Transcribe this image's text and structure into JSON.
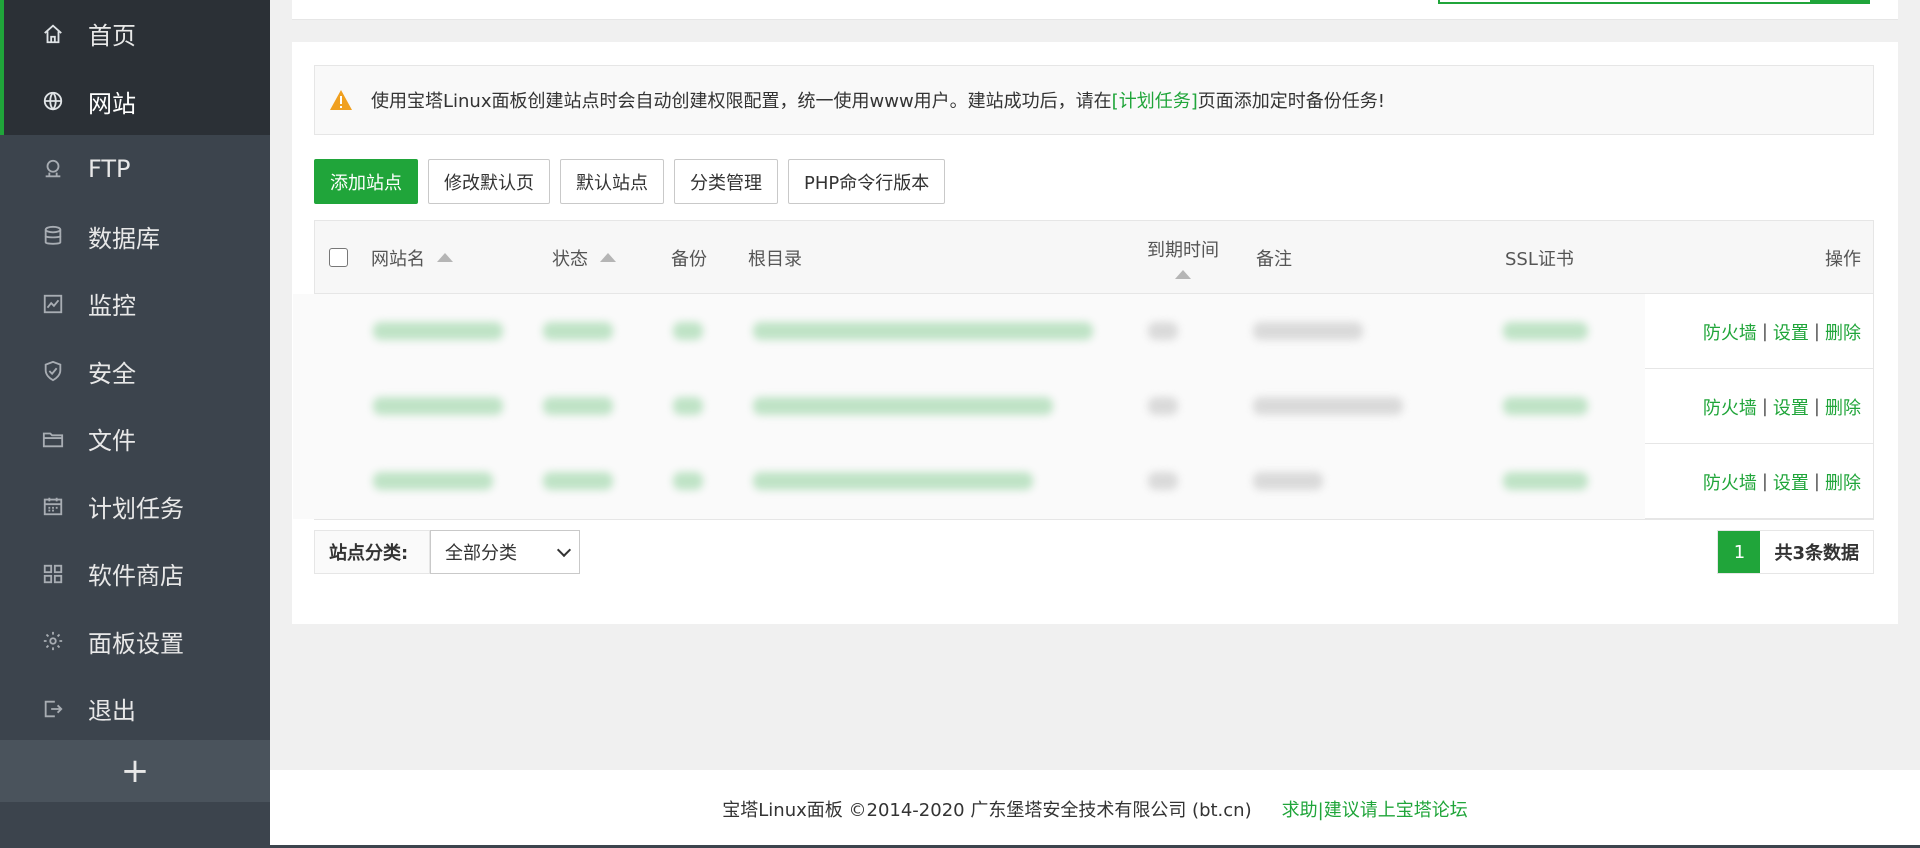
{
  "colors": {
    "accent": "#20a53a",
    "sidebar_bg": "#3c444d",
    "sidebar_active": "#2b3036"
  },
  "sidebar": {
    "items": [
      {
        "label": "首页",
        "icon": "home-icon"
      },
      {
        "label": "网站",
        "icon": "globe-icon"
      },
      {
        "label": "FTP",
        "icon": "ftp-icon"
      },
      {
        "label": "数据库",
        "icon": "database-icon"
      },
      {
        "label": "监控",
        "icon": "monitor-icon"
      },
      {
        "label": "安全",
        "icon": "shield-icon"
      },
      {
        "label": "文件",
        "icon": "folder-icon"
      },
      {
        "label": "计划任务",
        "icon": "calendar-icon"
      },
      {
        "label": "软件商店",
        "icon": "apps-icon"
      },
      {
        "label": "面板设置",
        "icon": "gear-icon"
      },
      {
        "label": "退出",
        "icon": "logout-icon"
      }
    ],
    "add_label": "+"
  },
  "alert": {
    "text_before": "使用宝塔Linux面板创建站点时会自动创建权限配置，统一使用www用户。建站成功后，请在",
    "link": "[计划任务]",
    "text_after": "页面添加定时备份任务!"
  },
  "toolbar": {
    "add_site": "添加站点",
    "edit_default_page": "修改默认页",
    "default_site": "默认站点",
    "category_manage": "分类管理",
    "php_cli_version": "PHP命令行版本"
  },
  "table": {
    "headers": {
      "site_name": "网站名",
      "status": "状态",
      "backup": "备份",
      "root_dir": "根目录",
      "expire": "到期时间",
      "remark": "备注",
      "ssl": "SSL证书",
      "ops": "操作"
    },
    "rows": [
      {
        "ops": {
          "firewall": "防火墙",
          "settings": "设置",
          "delete": "删除"
        }
      },
      {
        "ops": {
          "firewall": "防火墙",
          "settings": "设置",
          "delete": "删除"
        }
      },
      {
        "ops": {
          "firewall": "防火墙",
          "settings": "设置",
          "delete": "删除"
        }
      }
    ],
    "separator": "|"
  },
  "filter": {
    "label": "站点分类:",
    "selected": "全部分类"
  },
  "pager": {
    "current": "1",
    "total": "共3条数据"
  },
  "footer": {
    "copyright": "宝塔Linux面板 ©2014-2020 广东堡塔安全技术有限公司 (bt.cn)",
    "help_link": "求助|建议请上宝塔论坛"
  }
}
